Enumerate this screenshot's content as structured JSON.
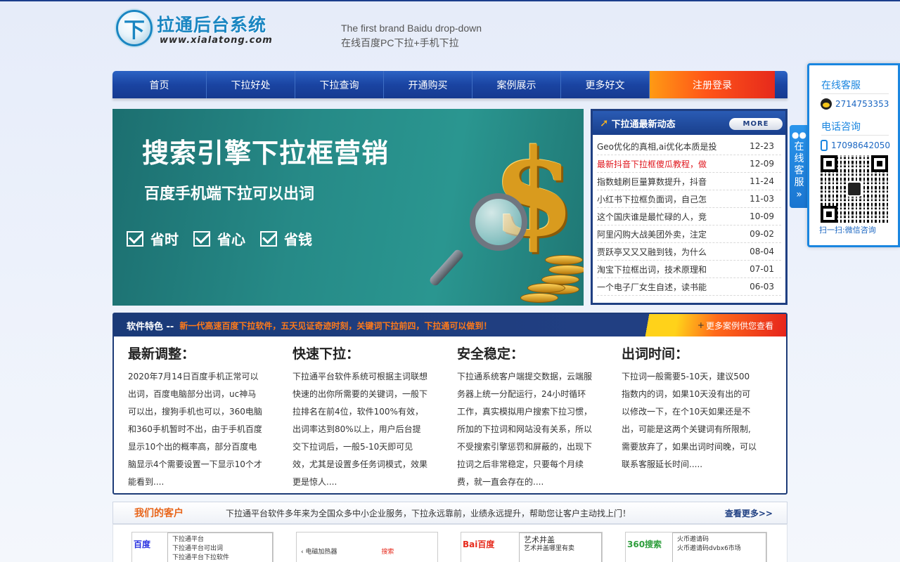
{
  "header": {
    "logo_glyph": "下",
    "logo_title": "拉通后台系统",
    "logo_url": "www.xialatong.com",
    "slogan_en": "The first brand Baidu drop-down",
    "slogan_cn": "在线百度PC下拉+手机下拉"
  },
  "nav": {
    "items": [
      "首页",
      "下拉好处",
      "下拉查询",
      "开通购买",
      "案例展示",
      "更多好文",
      "注册登录"
    ]
  },
  "banner": {
    "title": "搜索引擎下拉框营销",
    "subtitle": "百度手机端下拉可以出词",
    "features": [
      "省时",
      "省心",
      "省钱"
    ],
    "dollar": "$"
  },
  "news": {
    "title": "下拉通最新动态",
    "more": "MORE",
    "items": [
      {
        "title": "Geo优化的真相,ai优化本质是投",
        "date": "12-23"
      },
      {
        "title": "最新抖音下拉框傻瓜教程，做",
        "date": "12-09"
      },
      {
        "title": "指数蛙刷巨量算数提升，抖音",
        "date": "11-24"
      },
      {
        "title": "小红书下拉框负面词，自己怎",
        "date": "11-03"
      },
      {
        "title": "这个国庆谁是最忙碌的人，竞",
        "date": "10-09"
      },
      {
        "title": "阿里闪购大战美团外卖，注定",
        "date": "09-02"
      },
      {
        "title": "贾跃亭又又又融到钱，为什么",
        "date": "08-04"
      },
      {
        "title": "淘宝下拉框出词，技术原理和",
        "date": "07-01"
      },
      {
        "title": "一个电子厂女生自述，读书能",
        "date": "06-03"
      }
    ]
  },
  "features": {
    "label": "软件特色 --",
    "tagline": "新一代高速百度下拉软件，五天见证奇迹时刻，关键词下拉前四，下拉通可以做到！",
    "more": "更多案例供您查看",
    "columns": [
      {
        "title": "最新调整：",
        "body": "2020年7月14日百度手机正常可以出词，百度电脑部分出词，uc神马可以出，搜狗手机也可以，360电脑和360手机暂时不出，由于手机百度显示10个出的概率高，部分百度电脑显示4个需要设置一下显示10个才能看到...."
      },
      {
        "title": "快速下拉：",
        "body": "下拉通平台软件系统可根据主词联想快速的出你所需要的关键词，一般下拉排名在前4位，软件100%有效，出词率达到80%以上，用户后台提交下拉词后，一般5-10天即可见效，尤其是设置多任务词模式，效果更是惊人...."
      },
      {
        "title": "安全稳定：",
        "body": "下拉通系统客户端提交数据，云端服务器上统一分配运行，24小时循环工作，真实模拟用户搜索下拉习惯，所加的下拉词和网站没有关系，所以不受搜索引擎惩罚和屏蔽的，出现下拉词之后非常稳定，只要每个月续费，就一直会存在的...."
      },
      {
        "title": "出词时间：",
        "body": "下拉词一般需要5-10天，建议500指数内的词，如果10天没有出的可以修改一下，在个10天如果还是不出，可能是这两个关键词有所限制,需要放弃了，如果出词时间晚，可以联系客服延长时间....."
      }
    ]
  },
  "customers": {
    "title": "我们的客户",
    "desc": "下拉通平台软件多年来为全国众多中小企业服务，下拉永远靠前，业绩永远提升，帮助您让客户主动找上门！",
    "more": "查看更多>>",
    "cards": [
      {
        "brand": "百度",
        "lines": [
          "下拉通平台",
          "下拉通平台可出词",
          "下拉通平台下拉软件"
        ]
      },
      {
        "brand": "",
        "lines": [
          "电磁加热器",
          "搜索"
        ]
      },
      {
        "brand": "Bai百度",
        "lines": [
          "艺术井盖",
          "艺术井盖哪里有卖"
        ]
      },
      {
        "brand": "360搜索",
        "lines": [
          "火币邀请码",
          "火币邀请码dvbx6市场"
        ]
      }
    ]
  },
  "side": {
    "tab_label": "在线客服",
    "tab_arrow": "»",
    "service_title": "在线客服",
    "qq": "2714753353",
    "phone_title": "电话咨询",
    "phone": "17098642050",
    "qr_caption": "扫一扫:微信咨询"
  }
}
